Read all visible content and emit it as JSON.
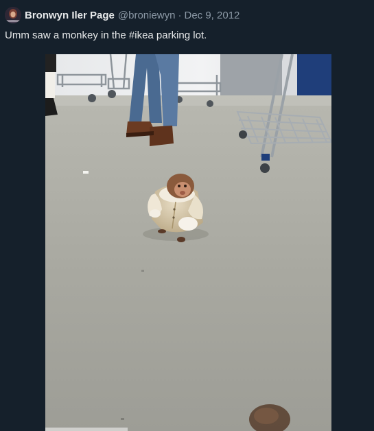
{
  "tweet": {
    "author": {
      "display_name": "Bronwyn Iler Page",
      "handle": "@broniewyn"
    },
    "separator": "·",
    "date": "Dec 9, 2012",
    "text": "Umm saw a monkey in the #ikea parking lot.",
    "photo": {
      "subject": "monkey-in-shearling-coat",
      "alt": "Monkey wearing a shearling coat sitting on a concrete floor near shopping carts"
    }
  },
  "colors": {
    "background": "#15202b",
    "primary_text": "#e7e9ea",
    "secondary_text": "#8b98a5"
  }
}
